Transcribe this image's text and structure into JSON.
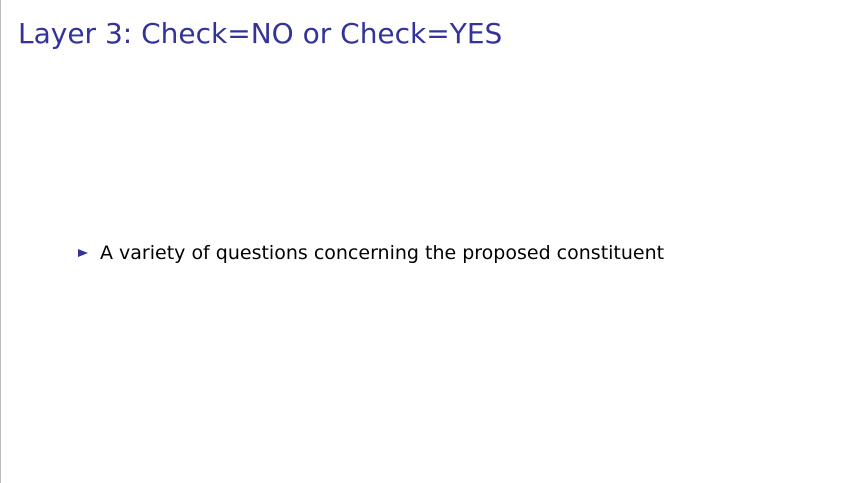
{
  "slide": {
    "title": "Layer 3:  Check=NO or Check=YES",
    "bullets": [
      {
        "text": "A variety of questions concerning the proposed constituent"
      }
    ]
  },
  "colors": {
    "title": "#33339a",
    "bullet_marker": "#33339a",
    "body_text": "#000000",
    "background": "#ffffff"
  },
  "icons": {
    "bullet_marker": "triangle-right-bullet-icon"
  }
}
